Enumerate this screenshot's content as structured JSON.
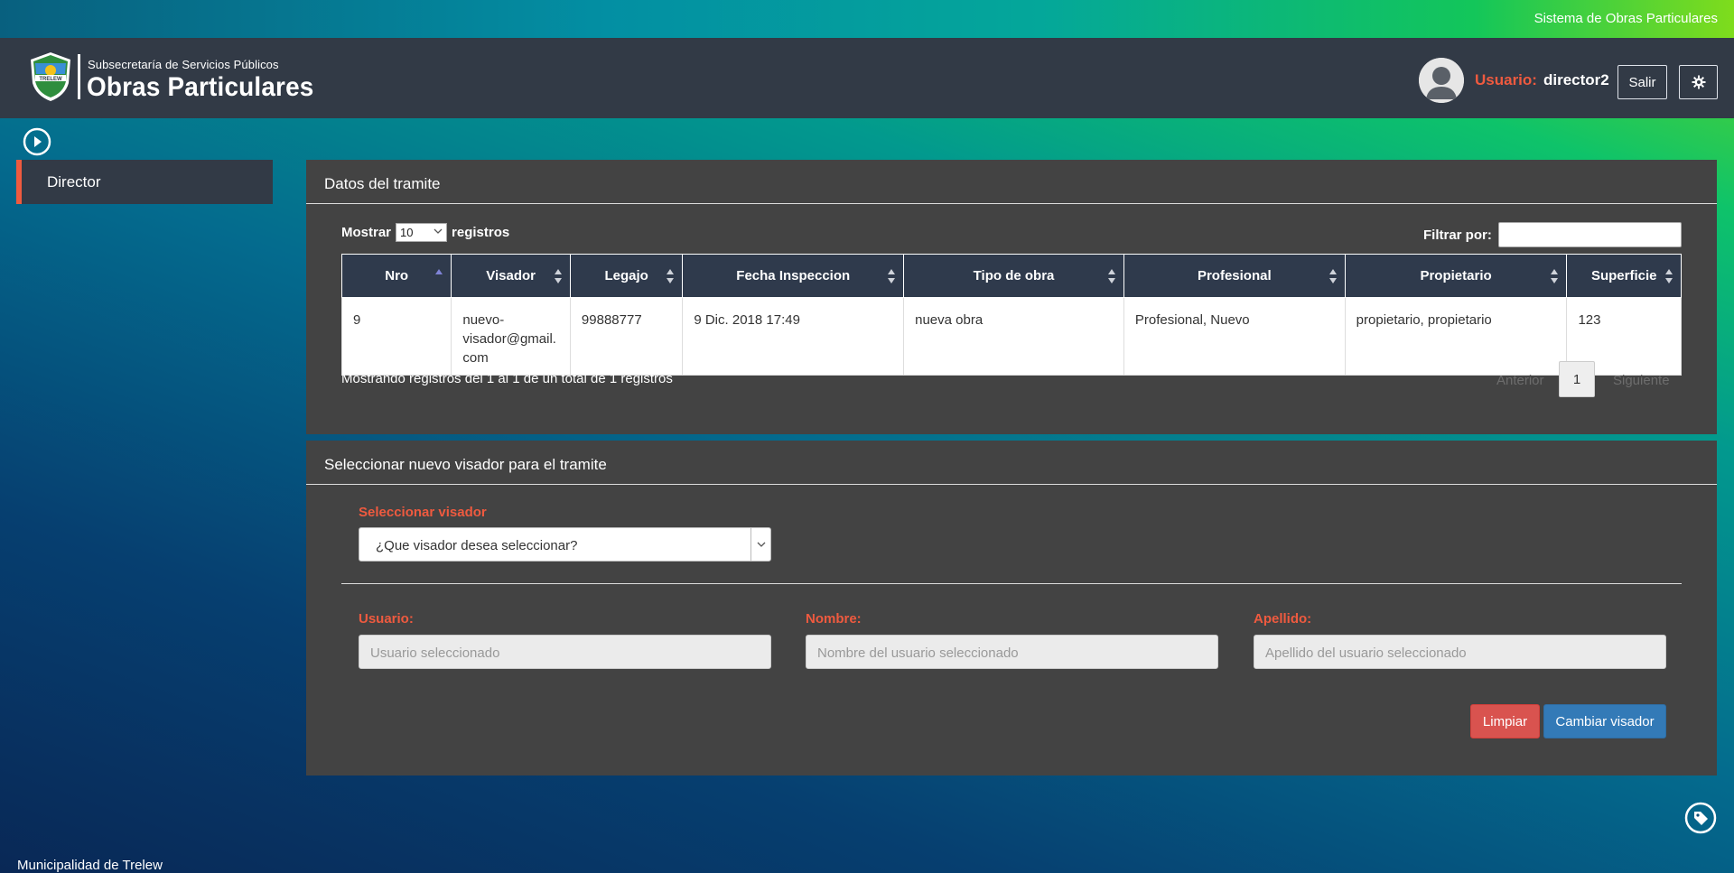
{
  "topbar": {
    "system_title": "Sistema de Obras Particulares"
  },
  "brand": {
    "subtitle": "Subsecretaría de Servicios Públicos",
    "title": "Obras Particulares",
    "logo_text": "TRELEW"
  },
  "user": {
    "label": "Usuario:",
    "name": "director2",
    "logout_label": "Salir"
  },
  "sidebar": {
    "items": [
      {
        "label": "Director"
      }
    ]
  },
  "panel_tramite": {
    "title": "Datos del tramite",
    "show_label_before": "Mostrar",
    "show_value": "10",
    "show_label_after": "registros",
    "filter_label": "Filtrar por:",
    "columns": [
      "Nro",
      "Visador",
      "Legajo",
      "Fecha Inspeccion",
      "Tipo de obra",
      "Profesional",
      "Propietario",
      "Superficie"
    ],
    "rows": [
      [
        "9",
        "nuevo-visador@gmail.com",
        "99888777",
        "9 Dic. 2018 17:49",
        "nueva obra",
        "Profesional, Nuevo",
        "propietario, propietario",
        "123"
      ]
    ],
    "info": "Mostrando registros del 1 al 1 de un total de 1 registros",
    "pager": {
      "prev": "Anterior",
      "page": "1",
      "next": "Siguiente"
    }
  },
  "panel_visador": {
    "title": "Seleccionar nuevo visador para el tramite",
    "select_label": "Seleccionar visador",
    "select_placeholder": "¿Que visador desea seleccionar?",
    "fields": [
      {
        "label": "Usuario:",
        "placeholder": "Usuario seleccionado"
      },
      {
        "label": "Nombre:",
        "placeholder": "Nombre del usuario seleccionado"
      },
      {
        "label": "Apellido:",
        "placeholder": "Apellido del usuario seleccionado"
      }
    ],
    "clear_label": "Limpiar",
    "change_label": "Cambiar visador"
  },
  "footer": {
    "text": "Municipalidad de Trelew"
  },
  "colors": {
    "accent": "#ef5a3f",
    "header": "#323a46",
    "panel": "#434343",
    "table_head": "#2f3a4c",
    "primary": "#337ab7",
    "danger": "#d9534f"
  }
}
